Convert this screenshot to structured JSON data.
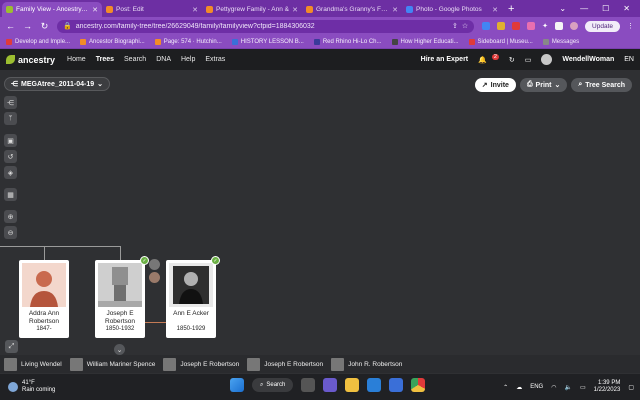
{
  "browser": {
    "tabs": [
      {
        "title": "Family View - Ancestry.com",
        "color": "#9cbe30",
        "active": true
      },
      {
        "title": "Post: Edit",
        "color": "#f28c28",
        "active": false
      },
      {
        "title": "Pettygrew Family - Ann &",
        "color": "#f28c28",
        "active": false
      },
      {
        "title": "Grandma's Granny's Fam",
        "color": "#f28c28",
        "active": false
      },
      {
        "title": "Photo - Google Photos",
        "color": "#4285f4",
        "active": false
      }
    ],
    "new_tab": "+",
    "url": "ancestry.com/family-tree/tree/26629049/family/familyview?cfpid=1884306032",
    "update_label": "Update",
    "bookmarks": [
      {
        "label": "Develop and Imple...",
        "color": "#e03a3a"
      },
      {
        "label": "Ancestor Biographi...",
        "color": "#f28c28"
      },
      {
        "label": "Page: 574 · Hutchin...",
        "color": "#f28c28"
      },
      {
        "label": "HISTORY LESSON B...",
        "color": "#3a6fd8"
      },
      {
        "label": "Red Rhino Hi-Lo Ch...",
        "color": "#3a3a9a"
      },
      {
        "label": "How Higher Educati...",
        "color": "#444"
      },
      {
        "label": "Sideboard | Museu...",
        "color": "#e03a3a"
      },
      {
        "label": "Messages",
        "color": "#888"
      }
    ]
  },
  "ancestry_nav": {
    "logo": "ancestry",
    "links": [
      "Home",
      "Trees",
      "Search",
      "DNA",
      "Help",
      "Extras"
    ],
    "active_link": "Trees",
    "hire": "Hire an Expert",
    "notification_count": "2",
    "username": "WendellWoman",
    "language": "EN"
  },
  "toolbar": {
    "tree_name": "MEGAtree_2011-04-19",
    "invite": "Invite",
    "print": "Print",
    "tree_search": "Tree Search"
  },
  "people": [
    {
      "name": "Addra Ann Robertson",
      "dates": "1847-"
    },
    {
      "name": "Joseph E Robertson",
      "dates": "1850-1932"
    },
    {
      "name": "Ann E Acker",
      "dates": "1850-1929"
    }
  ],
  "recent": [
    {
      "name": "Living Wendel"
    },
    {
      "name": "William Mariner Spence"
    },
    {
      "name": "Joseph E Robertson"
    },
    {
      "name": "Joseph E Robertson"
    },
    {
      "name": "John R. Robertson"
    }
  ],
  "taskbar": {
    "temp": "41°F",
    "weather": "Rain coming",
    "search": "Search",
    "lang": "ENG",
    "time": "1:39 PM",
    "date": "1/22/2023"
  }
}
